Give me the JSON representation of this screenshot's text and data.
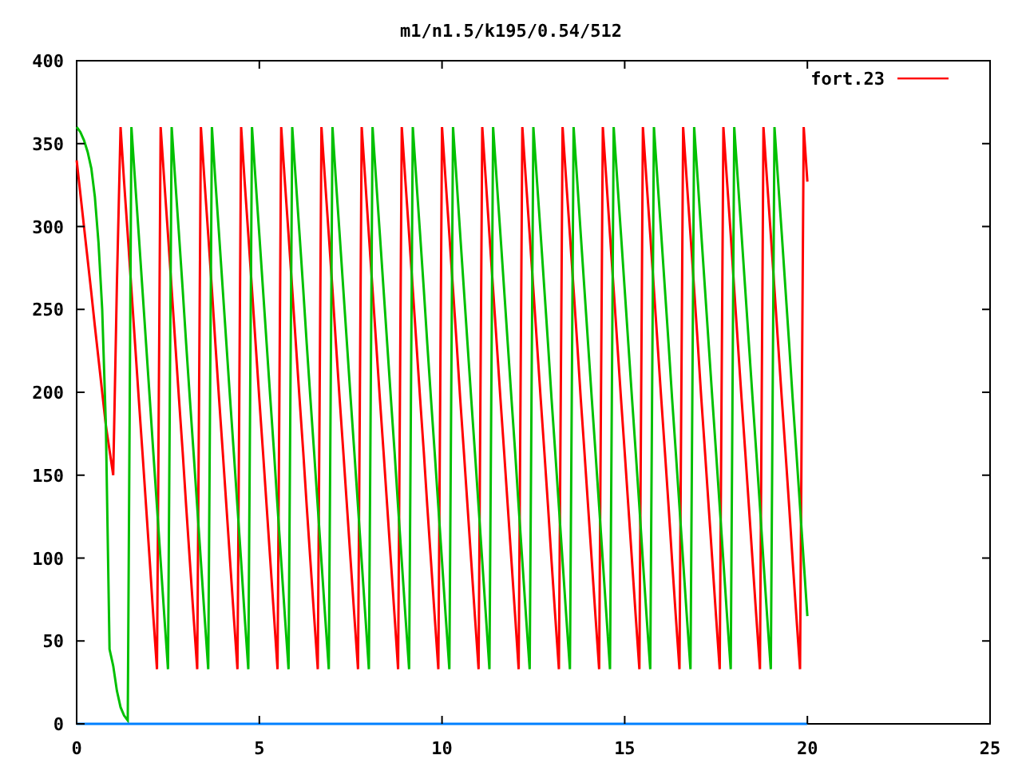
{
  "chart_data": {
    "type": "line",
    "title": "m1/n1.5/k195/0.54/512",
    "xlim": [
      0,
      25
    ],
    "ylim": [
      0,
      400
    ],
    "xticks": [
      0,
      5,
      10,
      15,
      20,
      25
    ],
    "yticks": [
      0,
      50,
      100,
      150,
      200,
      250,
      300,
      350,
      400
    ],
    "x": [
      0,
      0.1,
      0.2,
      0.3,
      0.4,
      0.5,
      0.6,
      0.7,
      0.8,
      0.9,
      1,
      1.1,
      1.2,
      1.3,
      1.4,
      1.5,
      1.6,
      1.7,
      1.8,
      1.9,
      2,
      2.1,
      2.2,
      2.3,
      2.4,
      2.5,
      2.6,
      2.7,
      2.8,
      2.9,
      3,
      3.1,
      3.2,
      3.3,
      3.4,
      3.5,
      3.6,
      3.7,
      3.8,
      3.9,
      4,
      4.1,
      4.2,
      4.3,
      4.4,
      4.5,
      4.6,
      4.7,
      4.8,
      4.9,
      5,
      5.1,
      5.2,
      5.3,
      5.4,
      5.5,
      5.6,
      5.7,
      5.8,
      5.9,
      6,
      6.1,
      6.2,
      6.3,
      6.4,
      6.5,
      6.6,
      6.7,
      6.8,
      6.9,
      7,
      7.1,
      7.2,
      7.3,
      7.4,
      7.5,
      7.6,
      7.7,
      7.8,
      7.9,
      8,
      8.1,
      8.2,
      8.3,
      8.4,
      8.5,
      8.6,
      8.7,
      8.8,
      8.9,
      9,
      9.1,
      9.2,
      9.3,
      9.4,
      9.5,
      9.6,
      9.7,
      9.8,
      9.9,
      10,
      10.1,
      10.2,
      10.3,
      10.4,
      10.5,
      10.6,
      10.7,
      10.8,
      10.9,
      11,
      11.1,
      11.2,
      11.3,
      11.4,
      11.5,
      11.6,
      11.7,
      11.8,
      11.9,
      12,
      12.1,
      12.2,
      12.3,
      12.4,
      12.5,
      12.6,
      12.7,
      12.8,
      12.9,
      13,
      13.1,
      13.2,
      13.3,
      13.4,
      13.5,
      13.6,
      13.7,
      13.8,
      13.9,
      14,
      14.1,
      14.2,
      14.3,
      14.4,
      14.5,
      14.6,
      14.7,
      14.8,
      14.9,
      15,
      15.1,
      15.2,
      15.3,
      15.4,
      15.5,
      15.6,
      15.7,
      15.8,
      15.9,
      16,
      16.1,
      16.2,
      16.3,
      16.4,
      16.5,
      16.6,
      16.7,
      16.8,
      16.9,
      17,
      17.1,
      17.2,
      17.3,
      17.4,
      17.5,
      17.6,
      17.7,
      17.8,
      17.9,
      18,
      18.1,
      18.2,
      18.3,
      18.4,
      18.5,
      18.6,
      18.7,
      18.8,
      18.9,
      19,
      19.1,
      19.2,
      19.3,
      19.4,
      19.5,
      19.6,
      19.7,
      19.8,
      19.9,
      20
    ],
    "series": [
      {
        "name": "fort.23",
        "color": "#ff0000",
        "values": [
          340,
          320,
          300,
          280,
          260,
          240,
          220,
          200,
          180,
          165,
          150,
          265,
          360,
          327,
          295,
          262,
          229,
          196,
          164,
          131,
          98,
          65,
          33,
          360,
          327,
          295,
          262,
          229,
          196,
          164,
          131,
          98,
          65,
          33,
          360,
          327,
          295,
          262,
          229,
          196,
          164,
          131,
          98,
          65,
          33,
          360,
          327,
          295,
          262,
          229,
          196,
          164,
          131,
          98,
          65,
          33,
          360,
          327,
          295,
          262,
          229,
          196,
          164,
          131,
          98,
          65,
          33,
          360,
          327,
          295,
          262,
          229,
          196,
          164,
          131,
          98,
          65,
          33,
          360,
          327,
          295,
          262,
          229,
          196,
          164,
          131,
          98,
          65,
          33,
          360,
          327,
          295,
          262,
          229,
          196,
          164,
          131,
          98,
          65,
          33,
          360,
          327,
          295,
          262,
          229,
          196,
          164,
          131,
          98,
          65,
          33,
          360,
          327,
          295,
          262,
          229,
          196,
          164,
          131,
          98,
          65,
          33,
          360,
          327,
          295,
          262,
          229,
          196,
          164,
          131,
          98,
          65,
          33,
          360,
          327,
          295,
          262,
          229,
          196,
          164,
          131,
          98,
          65,
          33,
          360,
          327,
          295,
          262,
          229,
          196,
          164,
          131,
          98,
          65,
          33,
          360,
          327,
          295,
          262,
          229,
          196,
          164,
          131,
          98,
          65,
          33,
          360,
          327,
          295,
          262,
          229,
          196,
          164,
          131,
          98,
          65,
          33,
          360,
          327,
          295,
          262,
          229,
          196,
          164,
          131,
          98,
          65,
          33,
          360,
          327,
          295,
          262,
          229,
          196,
          164,
          131,
          98,
          65,
          33,
          360,
          327
        ]
      },
      {
        "color": "#00c000",
        "values": [
          360,
          357,
          352,
          345,
          335,
          318,
          290,
          250,
          180,
          45,
          35,
          20,
          10,
          5,
          2,
          360,
          327,
          295,
          262,
          229,
          196,
          164,
          131,
          98,
          65,
          33,
          360,
          327,
          295,
          262,
          229,
          196,
          164,
          131,
          98,
          65,
          33,
          360,
          327,
          295,
          262,
          229,
          196,
          164,
          131,
          98,
          65,
          33,
          360,
          327,
          295,
          262,
          229,
          196,
          164,
          131,
          98,
          65,
          33,
          360,
          327,
          295,
          262,
          229,
          196,
          164,
          131,
          98,
          65,
          33,
          360,
          327,
          295,
          262,
          229,
          196,
          164,
          131,
          98,
          65,
          33,
          360,
          327,
          295,
          262,
          229,
          196,
          164,
          131,
          98,
          65,
          33,
          360,
          327,
          295,
          262,
          229,
          196,
          164,
          131,
          98,
          65,
          33,
          360,
          327,
          295,
          262,
          229,
          196,
          164,
          131,
          98,
          65,
          33,
          360,
          327,
          295,
          262,
          229,
          196,
          164,
          131,
          98,
          65,
          33,
          360,
          327,
          295,
          262,
          229,
          196,
          164,
          131,
          98,
          65,
          33,
          360,
          327,
          295,
          262,
          229,
          196,
          164,
          131,
          98,
          65,
          33,
          360,
          327,
          295,
          262,
          229,
          196,
          164,
          131,
          98,
          65,
          33,
          360,
          327,
          295,
          262,
          229,
          196,
          164,
          131,
          98,
          65,
          33,
          360,
          327,
          295,
          262,
          229,
          196,
          164,
          131,
          98,
          65,
          33,
          360,
          327,
          295,
          262,
          229,
          196,
          164,
          131,
          98,
          65,
          33,
          360,
          327,
          295,
          262,
          229,
          196,
          164,
          131,
          98,
          65
        ]
      },
      {
        "color": "#0080ff",
        "values": [
          0,
          0,
          0,
          0,
          0,
          0,
          0,
          0,
          0,
          0,
          0,
          0,
          0,
          0,
          0,
          0,
          0,
          0,
          0,
          0,
          0,
          0,
          0,
          0,
          0,
          0,
          0,
          0,
          0,
          0,
          0,
          0,
          0,
          0,
          0,
          0,
          0,
          0,
          0,
          0,
          0,
          0,
          0,
          0,
          0,
          0,
          0,
          0,
          0,
          0,
          0,
          0,
          0,
          0,
          0,
          0,
          0,
          0,
          0,
          0,
          0,
          0,
          0,
          0,
          0,
          0,
          0,
          0,
          0,
          0,
          0,
          0,
          0,
          0,
          0,
          0,
          0,
          0,
          0,
          0,
          0,
          0,
          0,
          0,
          0,
          0,
          0,
          0,
          0,
          0,
          0,
          0,
          0,
          0,
          0,
          0,
          0,
          0,
          0,
          0,
          0,
          0,
          0,
          0,
          0,
          0,
          0,
          0,
          0,
          0,
          0,
          0,
          0,
          0,
          0,
          0,
          0,
          0,
          0,
          0,
          0,
          0,
          0,
          0,
          0,
          0,
          0,
          0,
          0,
          0,
          0,
          0,
          0,
          0,
          0,
          0,
          0,
          0,
          0,
          0,
          0,
          0,
          0,
          0,
          0,
          0,
          0,
          0,
          0,
          0,
          0,
          0,
          0,
          0,
          0,
          0,
          0,
          0,
          0,
          0,
          0,
          0,
          0,
          0,
          0,
          0,
          0,
          0,
          0,
          0,
          0,
          0,
          0,
          0,
          0,
          0,
          0,
          0,
          0,
          0,
          0,
          0,
          0,
          0,
          0,
          0,
          0,
          0,
          0,
          0,
          0,
          0,
          0,
          0,
          0,
          0,
          0,
          0,
          0,
          0,
          0
        ]
      }
    ]
  }
}
